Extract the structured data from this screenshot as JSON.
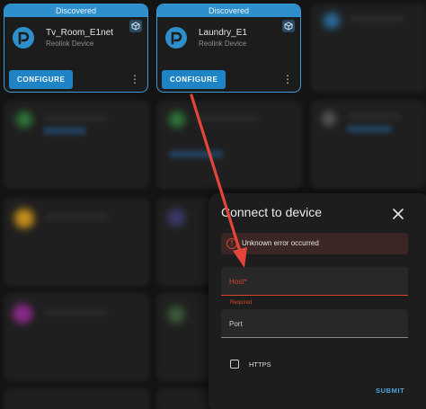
{
  "cards": [
    {
      "banner": "Discovered",
      "name": "Tv_Room_E1net",
      "subtitle": "Reolink Device",
      "configure_label": "CONFIGURE",
      "more_glyph": "⋮"
    },
    {
      "banner": "Discovered",
      "name": "Laundry_E1",
      "subtitle": "Reolink Device",
      "configure_label": "CONFIGURE",
      "more_glyph": "⋮"
    }
  ],
  "dialog": {
    "title": "Connect to device",
    "error_icon": "!",
    "error_text": "Unknown error occurred",
    "host_label": "Host*",
    "host_helper": "Required",
    "port_label": "Port",
    "https_label": "HTTPS",
    "submit_label": "SUBMIT"
  },
  "colors": {
    "accent": "#1f84c6",
    "banner": "#2d8fcc",
    "error": "#d5462f",
    "arrow": "#e2463b",
    "background": "#141414",
    "dialog": "#1d1d1d"
  },
  "icons": [
    "reolink-logo-icon",
    "package-badge-icon",
    "more-vert-icon",
    "close-icon",
    "error-icon",
    "checkbox-icon",
    "annotation-arrow"
  ]
}
